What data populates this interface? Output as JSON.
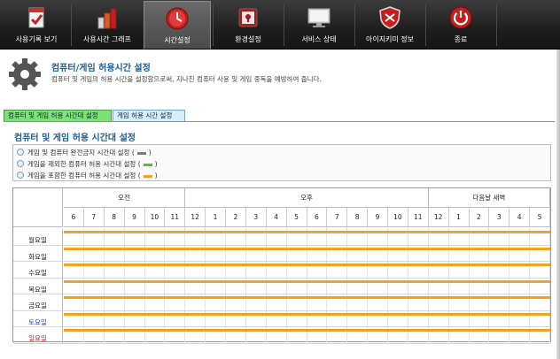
{
  "toolbar": {
    "items": [
      {
        "label": "사용기록 보기",
        "icon": "report-icon"
      },
      {
        "label": "사용시간 그래프",
        "icon": "bar-graph-icon"
      },
      {
        "label": "시간설정",
        "icon": "clock-icon",
        "active": true
      },
      {
        "label": "환경설정",
        "icon": "lock-settings-icon"
      },
      {
        "label": "서비스 상태",
        "icon": "monitor-icon"
      },
      {
        "label": "아이지키미 정보",
        "icon": "shield-icon"
      },
      {
        "label": "종료",
        "icon": "power-icon"
      }
    ]
  },
  "header": {
    "title": "컴퓨터/게임 허용시간 설정",
    "description": "컴퓨터 및 게임의 허용 시간을 설정함으로써, 지나친 컴퓨터 사용 및 게임 중독을 예방하여 줍니다."
  },
  "tabs": [
    {
      "label": "컴퓨터 및 게임 허용 시간대 설정",
      "active": true
    },
    {
      "label": "게임 허용 시간 설정",
      "active": false
    }
  ],
  "section_title": "컴퓨터 및 게임 허용 시간대 설정",
  "legend": [
    {
      "label": "게임 및 컴퓨터 완전금지 시간대 설정",
      "open": "(",
      "close": ")",
      "color": "#7a7a7a"
    },
    {
      "label": "게임을 제외한 컴퓨터 허용 시간대 설정",
      "open": "(",
      "close": ")",
      "color": "#52c22a"
    },
    {
      "label": "게임을 포함한 컴퓨터 허용 시간대 설정",
      "open": "(",
      "close": ")",
      "color": "#f3a31f"
    }
  ],
  "schedule": {
    "periods": [
      {
        "label": "오전",
        "span": 6
      },
      {
        "label": "오후",
        "span": 12
      },
      {
        "label": "다음날 새벽",
        "span": 6
      }
    ],
    "hours": [
      "6",
      "7",
      "8",
      "9",
      "10",
      "11",
      "12",
      "1",
      "2",
      "3",
      "4",
      "5",
      "6",
      "7",
      "8",
      "9",
      "10",
      "11",
      "12",
      "1",
      "2",
      "3",
      "4",
      "5"
    ],
    "days": [
      {
        "label": "월요일",
        "type": "weekday"
      },
      {
        "label": "화요일",
        "type": "weekday"
      },
      {
        "label": "수요일",
        "type": "weekday"
      },
      {
        "label": "목요일",
        "type": "weekday"
      },
      {
        "label": "금요일",
        "type": "weekday"
      },
      {
        "label": "토요일",
        "type": "sat"
      },
      {
        "label": "일요일",
        "type": "sun"
      }
    ],
    "allowed_color": "#f3a31f"
  }
}
